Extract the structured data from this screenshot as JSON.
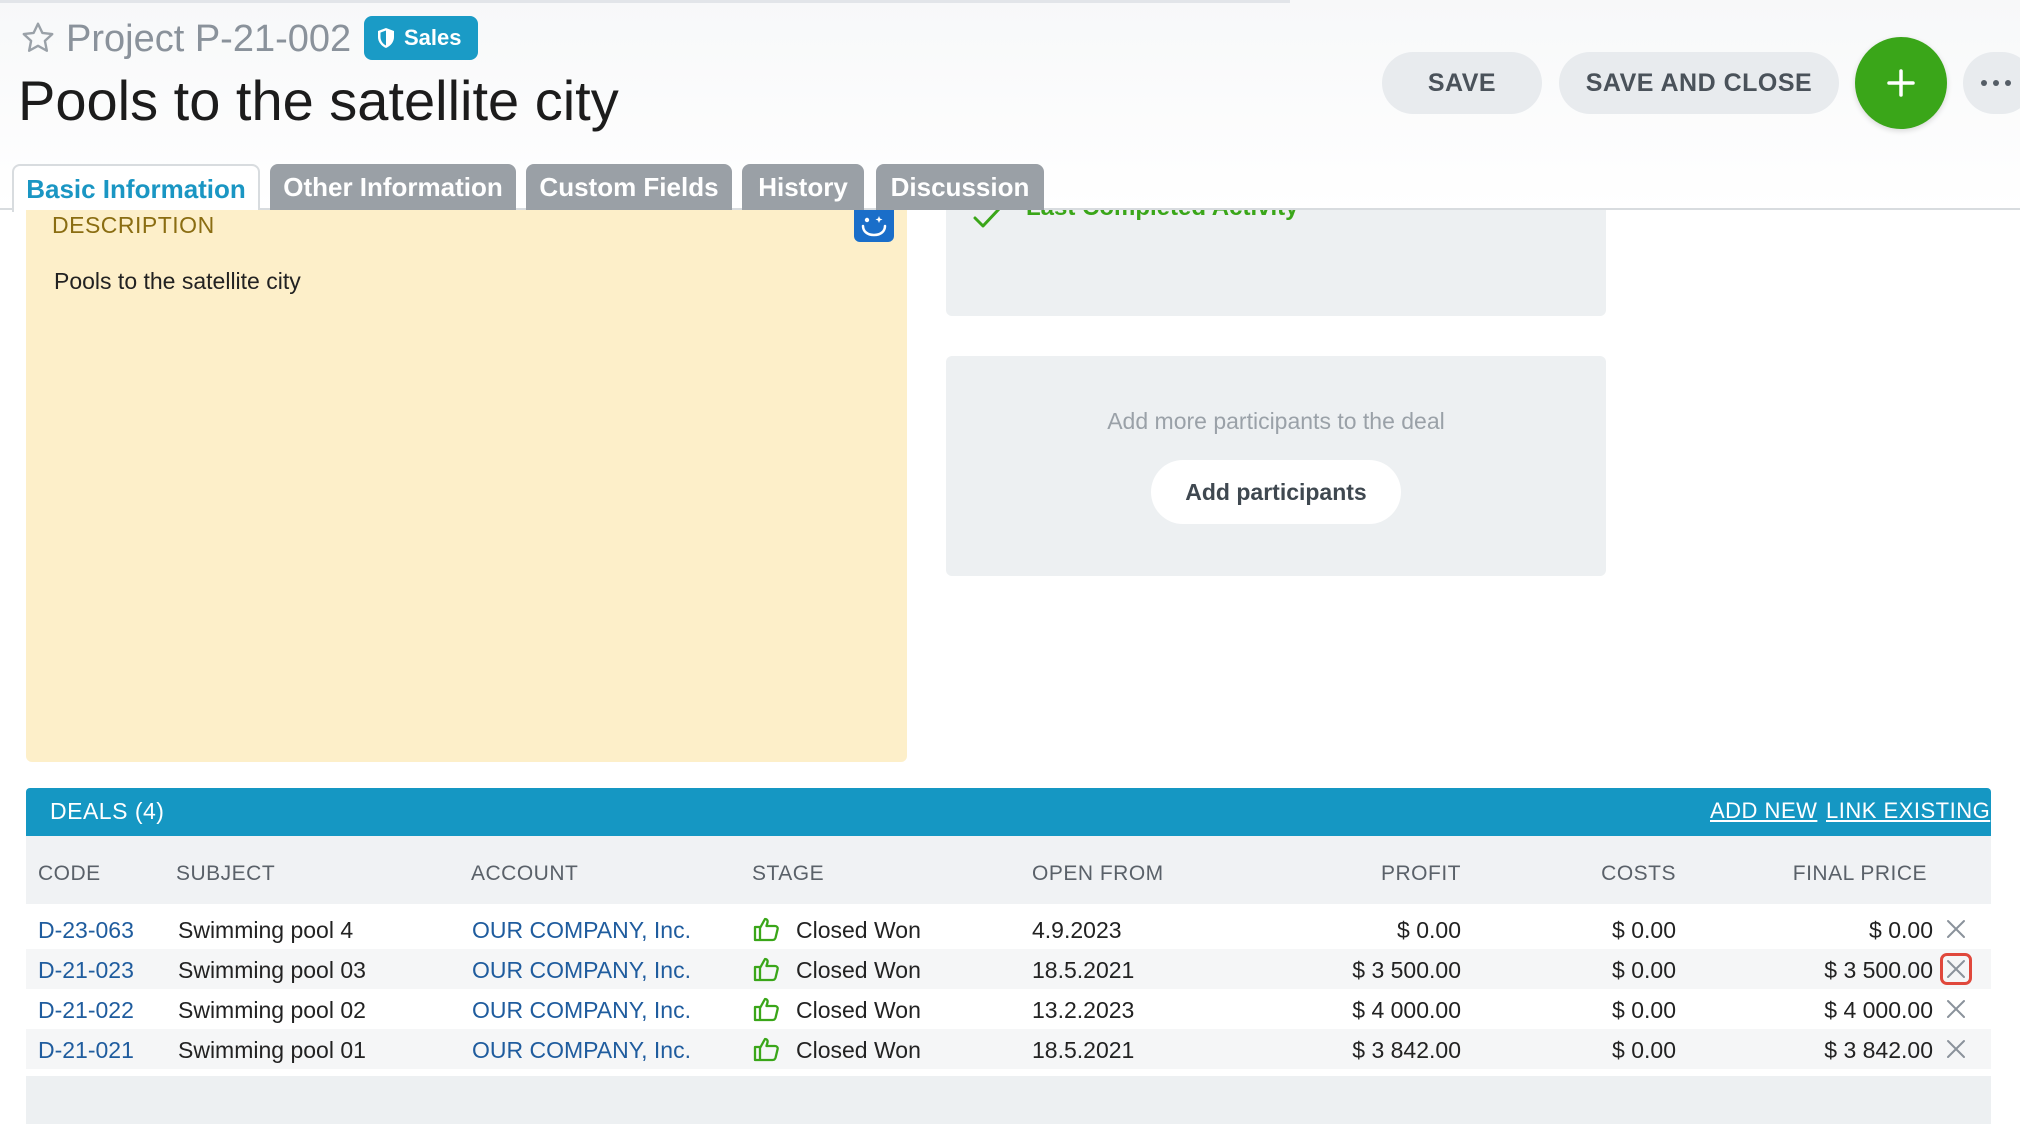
{
  "header": {
    "project_code": "Project P-21-002",
    "badge_label": "Sales",
    "title": "Pools to the satellite city",
    "save_label": "SAVE",
    "save_close_label": "SAVE AND CLOSE"
  },
  "tabs": [
    {
      "label": "Basic Information",
      "active": true
    },
    {
      "label": "Other Information",
      "active": false
    },
    {
      "label": "Custom Fields",
      "active": false
    },
    {
      "label": "History",
      "active": false
    },
    {
      "label": "Discussion",
      "active": false
    }
  ],
  "description": {
    "label": "DESCRIPTION",
    "text": "Pools to the satellite city"
  },
  "activity": {
    "label": "Last Completed Activity"
  },
  "participants": {
    "prompt": "Add more participants to the deal",
    "button_label": "Add participants"
  },
  "deals": {
    "title": "DEALS (4)",
    "add_new_label": "ADD NEW",
    "link_existing_label": "LINK EXISTING",
    "columns": [
      "CODE",
      "SUBJECT",
      "ACCOUNT",
      "STAGE",
      "OPEN FROM",
      "PROFIT",
      "COSTS",
      "FINAL PRICE"
    ],
    "rows": [
      {
        "code": "D-23-063",
        "subject": "Swimming pool 4",
        "account": "OUR COMPANY, Inc.",
        "stage": "Closed Won",
        "open_from": "4.9.2023",
        "profit": "$ 0.00",
        "costs": "$ 0.00",
        "final_price": "$ 0.00"
      },
      {
        "code": "D-21-023",
        "subject": "Swimming pool 03",
        "account": "OUR COMPANY, Inc.",
        "stage": "Closed Won",
        "open_from": "18.5.2021",
        "profit": "$ 3 500.00",
        "costs": "$ 0.00",
        "final_price": "$ 3 500.00"
      },
      {
        "code": "D-21-022",
        "subject": "Swimming pool 02",
        "account": "OUR COMPANY, Inc.",
        "stage": "Closed Won",
        "open_from": "13.2.2023",
        "profit": "$ 4 000.00",
        "costs": "$ 0.00",
        "final_price": "$ 4 000.00"
      },
      {
        "code": "D-21-021",
        "subject": "Swimming pool 01",
        "account": "OUR COMPANY, Inc.",
        "stage": "Closed Won",
        "open_from": "18.5.2021",
        "profit": "$ 3 842.00",
        "costs": "$ 0.00",
        "final_price": "$ 3 842.00"
      }
    ]
  },
  "colors": {
    "accent": "#1597c3",
    "add_button": "#3aa619",
    "description_bg": "#fdefc9",
    "highlight": "#e0483c"
  },
  "icons": {
    "favorite": "star-icon",
    "badge": "shield-icon",
    "add": "plus-icon",
    "more": "more-dots-icon",
    "stage": "thumbs-up-icon",
    "remove": "close-icon"
  }
}
